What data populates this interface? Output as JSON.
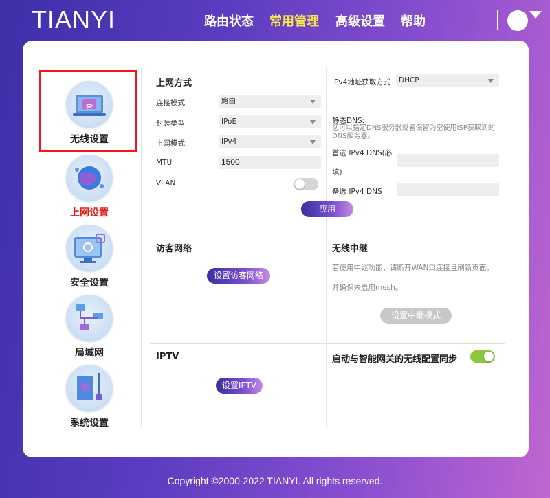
{
  "header": {
    "logo": "TIANYI",
    "nav": [
      "路由状态",
      "常用管理",
      "高级设置",
      "帮助"
    ],
    "active_nav": "常用管理"
  },
  "sidebar": {
    "items": [
      {
        "label": "无线设置",
        "icon": "wifi-monitor-icon",
        "highlighted": true
      },
      {
        "label": "上网设置",
        "icon": "globe-network-icon",
        "active": true
      },
      {
        "label": "安全设置",
        "icon": "security-monitor-icon"
      },
      {
        "label": "局域网",
        "icon": "lan-topology-icon"
      },
      {
        "label": "系统设置",
        "icon": "circuit-board-icon"
      }
    ]
  },
  "internet": {
    "title": "上网方式",
    "connection_mode_label": "连接模式",
    "connection_mode_value": "路由",
    "encap_label": "封装类型",
    "encap_value": "IPoE",
    "net_mode_label": "上网模式",
    "net_mode_value": "IPv4",
    "mtu_label": "MTU",
    "mtu_value": "1500",
    "vlan_label": "VLAN",
    "vlan_on": false
  },
  "ipv4": {
    "method_label": "IPv4地址获取方式",
    "method_value": "DHCP",
    "static_dns_title": "静态DNS:",
    "static_dns_hint": "您可以指定DNS服务器或者保留为空使用ISP获取到的DNS服务器。",
    "primary_dns_label_1": "首选 IPv4 DNS(必",
    "primary_dns_label_2": "填)",
    "primary_dns_value": "",
    "secondary_dns_label": "备选 IPv4 DNS",
    "secondary_dns_value": ""
  },
  "apply_button": "应用",
  "guest": {
    "title": "访客网络",
    "button": "设置访客网络"
  },
  "relay": {
    "title": "无线中继",
    "hint_1": "若使用中继功能，请断开WAN口连接且刷新页面，",
    "hint_2": "并确保未启用mesh。",
    "button": "设置中继模式"
  },
  "iptv": {
    "title": "IPTV",
    "button": "设置IPTV"
  },
  "sync": {
    "label": "启动与智能网关的无线配置同步",
    "on": true
  },
  "colors": {
    "accent_yellow": "#f6e64a",
    "active_red": "#e0201a",
    "toggle_green": "#8dc63f",
    "highlight_box": "#f2161a"
  },
  "footer": "Copyright ©2000-2022 TIANYI. All rights reserved."
}
